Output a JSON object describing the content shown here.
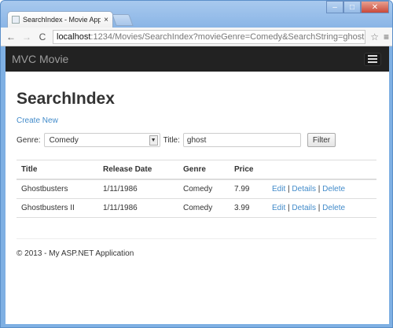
{
  "browser": {
    "tab_title": "SearchIndex - Movie App",
    "tab_close": "×",
    "url_host": "localhost",
    "url_rest": ":1234/Movies/SearchIndex?movieGenre=Comedy&SearchString=ghost",
    "back": "←",
    "forward": "→",
    "reload": "C",
    "star": "☆",
    "menu": "≡",
    "min": "–",
    "max": "□",
    "close": "✕"
  },
  "navbar": {
    "brand": "MVC Movie"
  },
  "page": {
    "title": "SearchIndex",
    "create_new": "Create New",
    "genre_label": "Genre:",
    "genre_value": "Comedy",
    "title_label": "Title:",
    "title_value": "ghost",
    "filter_button": "Filter"
  },
  "table": {
    "headers": [
      "Title",
      "Release Date",
      "Genre",
      "Price"
    ],
    "rows": [
      {
        "title": "Ghostbusters",
        "release": "1/11/1986",
        "genre": "Comedy",
        "price": "7.99"
      },
      {
        "title": "Ghostbusters II",
        "release": "1/11/1986",
        "genre": "Comedy",
        "price": "3.99"
      }
    ],
    "actions": {
      "edit": "Edit",
      "details": "Details",
      "delete": "Delete",
      "separator": "|"
    }
  },
  "footer": {
    "text": "© 2013 - My ASP.NET Application"
  },
  "colors": {
    "navbar_bg": "#222222",
    "link": "#428bca",
    "brand": "#9d9d9d"
  }
}
